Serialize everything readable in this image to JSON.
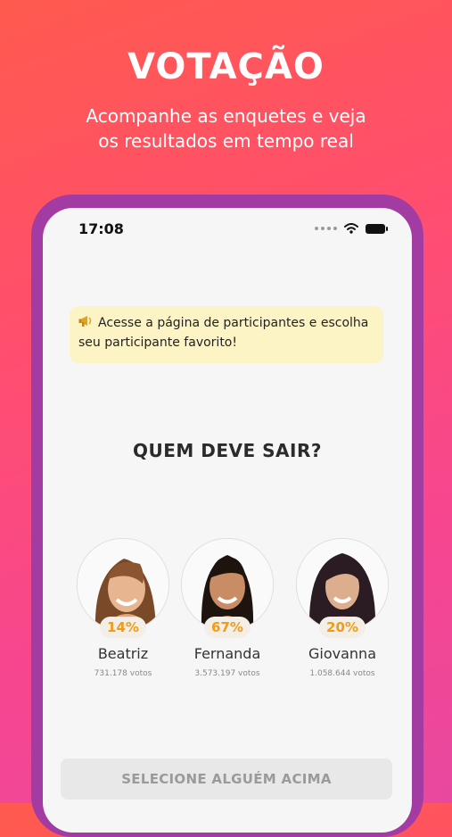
{
  "header": {
    "title": "VOTAÇÃO",
    "subtitle": "Acompanhe as enquetes e veja\nos resultados em tempo real"
  },
  "status_bar": {
    "time": "17:08"
  },
  "notice": {
    "icon": "megaphone-icon",
    "text": "Acesse a página de participantes e escolha seu participante favorito!"
  },
  "poll": {
    "question": "QUEM DEVE SAIR?",
    "candidates": [
      {
        "name": "Beatriz",
        "percent": "14%",
        "votes": "731.178 votos"
      },
      {
        "name": "Fernanda",
        "percent": "67%",
        "votes": "3.573.197 votos"
      },
      {
        "name": "Giovanna",
        "percent": "20%",
        "votes": "1.058.644 votos"
      }
    ],
    "button_label": "SELECIONE ALGUÉM ACIMA"
  },
  "colors": {
    "accent": "#f39b14",
    "phone_frame": "#a23ca2",
    "notice_bg": "#fdf4c6"
  }
}
